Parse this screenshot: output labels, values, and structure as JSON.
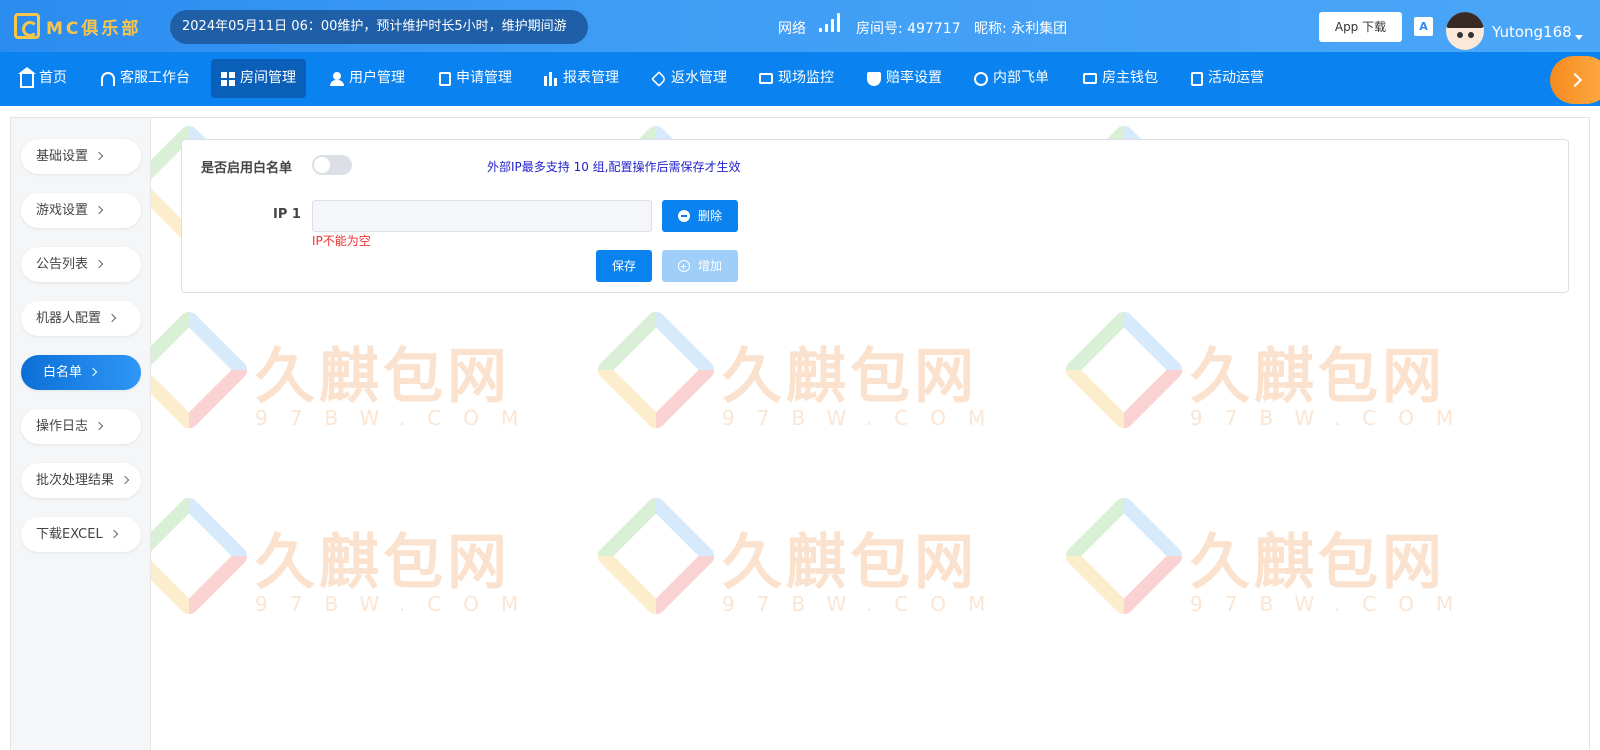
{
  "brand": {
    "logo_text": "MC俱乐部"
  },
  "header": {
    "notice": "2024年05月11日 06：00维护，预计维护时长5小时，维护期间游",
    "network_label": "网络",
    "room_number": "房间号: 497717",
    "nickname": "昵称: 永利集团",
    "app_download": "App 下载",
    "lang_icon": "A",
    "username": "Yutong168"
  },
  "nav": {
    "items": [
      {
        "label": "首页",
        "icon": "home-icon"
      },
      {
        "label": "客服工作台",
        "icon": "headset-icon"
      },
      {
        "label": "房间管理",
        "icon": "grid-icon",
        "active": true
      },
      {
        "label": "用户管理",
        "icon": "user-icon"
      },
      {
        "label": "申请管理",
        "icon": "document-icon"
      },
      {
        "label": "报表管理",
        "icon": "bar-chart-icon"
      },
      {
        "label": "返水管理",
        "icon": "tag-icon"
      },
      {
        "label": "现场监控",
        "icon": "monitor-icon"
      },
      {
        "label": "赔率设置",
        "icon": "shield-icon"
      },
      {
        "label": "内部飞单",
        "icon": "clock-icon"
      },
      {
        "label": "房主钱包",
        "icon": "wallet-icon"
      },
      {
        "label": "活动运营",
        "icon": "yen-icon"
      }
    ]
  },
  "sidebar": {
    "items": [
      {
        "label": "基础设置"
      },
      {
        "label": "游戏设置"
      },
      {
        "label": "公告列表"
      },
      {
        "label": "机器人配置"
      },
      {
        "label": "白名单",
        "active": true
      },
      {
        "label": "操作日志"
      },
      {
        "label": "批次处理结果"
      },
      {
        "label": "下载EXCEL"
      }
    ]
  },
  "whitelist": {
    "enable_label": "是否启用白名单",
    "enabled": false,
    "tip": "外部IP最多支持 10 组,配置操作后需保存才生效",
    "ip_label": "IP 1",
    "ip_value": "",
    "ip_error": "IP不能为空",
    "delete_label": "删除",
    "save_label": "保存",
    "add_label": "增加"
  },
  "watermark": {
    "text": "久麒包网",
    "sub": "97BW.COM"
  },
  "colors": {
    "primary": "#0a82f0",
    "nav_active": "#0a5fb8",
    "error": "#f03030",
    "tip": "#2222cc",
    "accent_orange": "#f58a1f"
  }
}
